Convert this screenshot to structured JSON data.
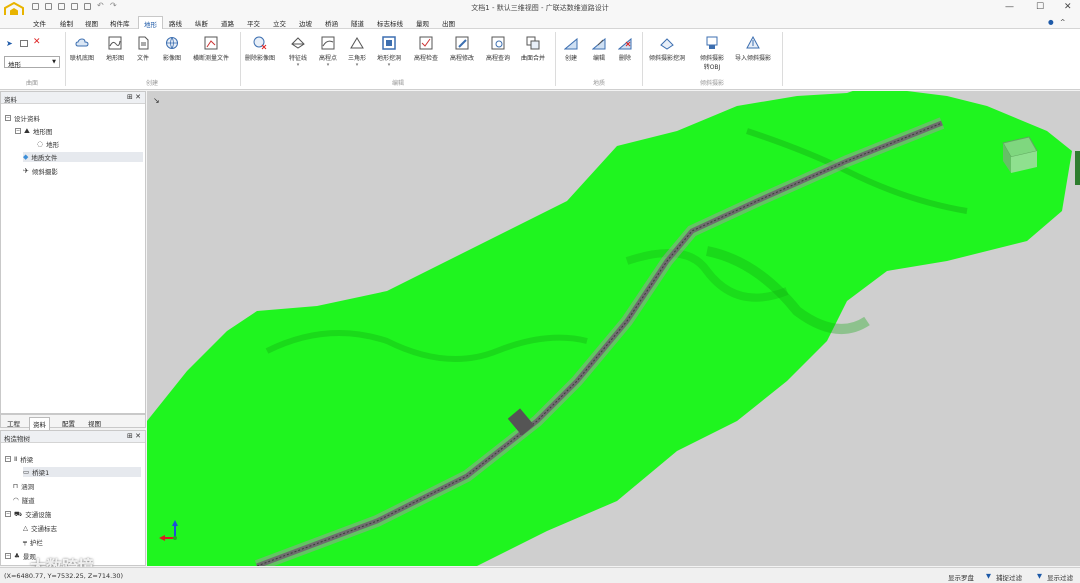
{
  "window": {
    "title": "文档1 - 默认三维视图 - 广联达数维道路设计",
    "minimize": "—",
    "maximize": "☐",
    "close": "✕"
  },
  "menu": [
    "文件",
    "绘制",
    "视图",
    "构件库",
    "地形",
    "路线",
    "纵断",
    "道路",
    "平交",
    "立交",
    "边坡",
    "桥涵",
    "隧道",
    "标志标线",
    "量观",
    "出图"
  ],
  "menu_active_index": 4,
  "ribbon": {
    "selector_value": "地形",
    "groups": {
      "curve": "曲面",
      "create": "创建",
      "edit": "编辑",
      "geology": "地质",
      "oblique": "倾斜摄影"
    },
    "buttons": {
      "online_map": "联机底图",
      "terrain_map": "地形图",
      "file": "文件",
      "image_map": "影像图",
      "cross_section_file": "横断测量文件",
      "delete_image": "删除影像图",
      "feature_line": "特征线",
      "elevation_point": "高程点",
      "triangle": "三角形",
      "terrain_excavation": "地形挖洞",
      "elevation_check": "高程检查",
      "elevation_modify": "高程修改",
      "elevation_query": "高程查询",
      "surface_merge": "曲面合并",
      "geo_create": "创建",
      "geo_edit": "编辑",
      "geo_delete": "删除",
      "oblique_excavation": "倾斜摄影挖洞",
      "oblique_obj_line1": "倾斜摄影",
      "oblique_obj_line2": "转OBJ",
      "import_oblique": "导入倾斜摄影"
    }
  },
  "resources_panel": {
    "title": "资料",
    "tree": {
      "root": "设计资料",
      "terrain_map": "地形图",
      "terrain": "地形",
      "geology_file": "地质文件",
      "oblique": "倾斜摄影"
    }
  },
  "tabs": [
    "工程",
    "资料",
    "配置",
    "视图"
  ],
  "tab_active_index": 1,
  "objects_panel": {
    "title": "构造物树",
    "tree": {
      "bridge": "桥梁",
      "bridge1": "桥梁1",
      "culvert": "涵洞",
      "tunnel": "隧道",
      "traffic": "交通设施",
      "traffic_sign": "交通标志",
      "guardrail": "护栏",
      "landscape": "景观"
    }
  },
  "status": {
    "coords": "(X=6480.77, Y=7532.25, Z=714.30)",
    "show_compass": "显示罗盘",
    "capture_filter": "捕捉过滤",
    "show_filter": "显示过滤"
  },
  "watermark": "大数跨境",
  "colors": {
    "terrain": "#1ff51f",
    "background": "#cfcfcf",
    "accent": "#1e5aa8",
    "road": "#6d6d6d"
  }
}
